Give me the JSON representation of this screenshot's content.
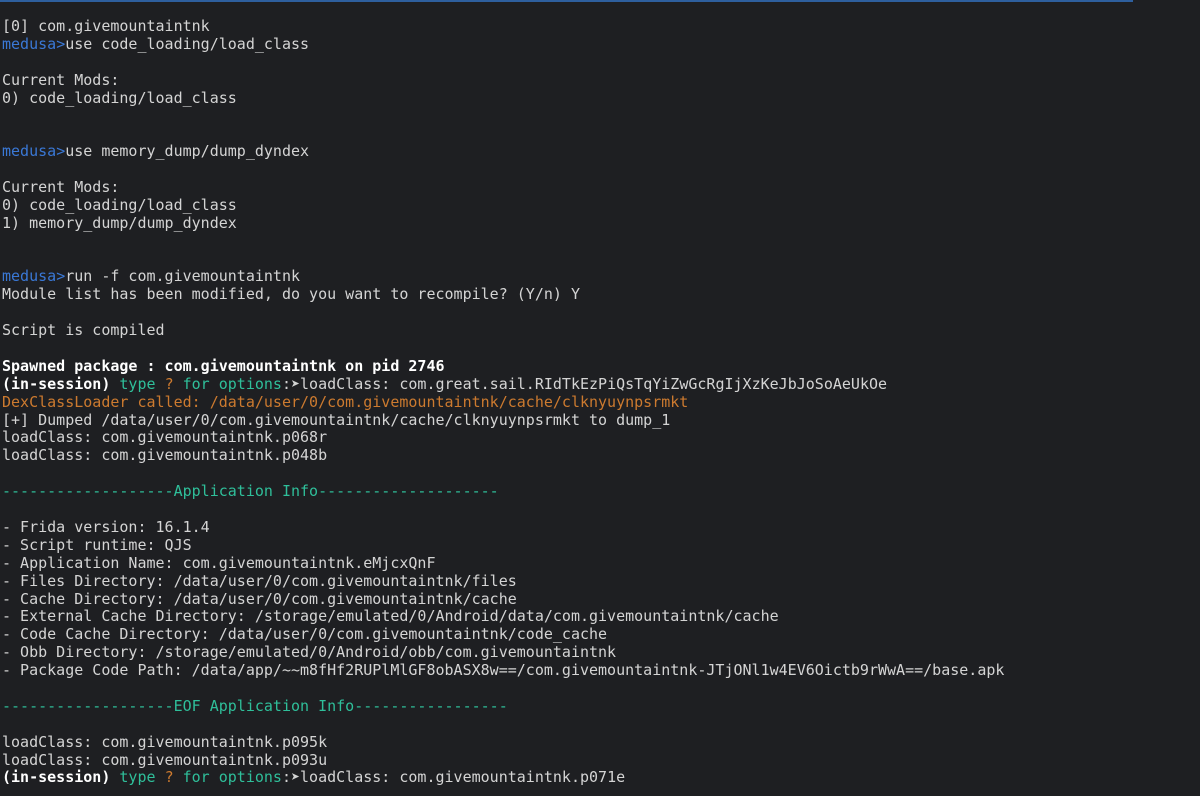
{
  "colors": {
    "background": "#1e1f22",
    "text": "#d4d4d4",
    "prompt_blue": "#3a78d6",
    "teal": "#2fbf9a",
    "orange": "#cc7a2f",
    "bold_white": "#ffffff",
    "top_accent": "#2e5f9e"
  },
  "terminal": {
    "lines": [
      {
        "segments": [
          {
            "text": "[0] com.givemountaintnk",
            "style": ""
          }
        ]
      },
      {
        "segments": [
          {
            "text": "medusa",
            "style": "blue"
          },
          {
            "text": ">",
            "style": "blue"
          },
          {
            "text": "use code_loading/load_class",
            "style": ""
          }
        ]
      },
      {
        "segments": []
      },
      {
        "segments": [
          {
            "text": "Current Mods:",
            "style": ""
          }
        ]
      },
      {
        "segments": [
          {
            "text": "0) code_loading/load_class",
            "style": ""
          }
        ]
      },
      {
        "segments": []
      },
      {
        "segments": []
      },
      {
        "segments": [
          {
            "text": "medusa",
            "style": "blue"
          },
          {
            "text": ">",
            "style": "blue"
          },
          {
            "text": "use memory_dump/dump_dyndex",
            "style": ""
          }
        ]
      },
      {
        "segments": []
      },
      {
        "segments": [
          {
            "text": "Current Mods:",
            "style": ""
          }
        ]
      },
      {
        "segments": [
          {
            "text": "0) code_loading/load_class",
            "style": ""
          }
        ]
      },
      {
        "segments": [
          {
            "text": "1) memory_dump/dump_dyndex",
            "style": ""
          }
        ]
      },
      {
        "segments": []
      },
      {
        "segments": []
      },
      {
        "segments": [
          {
            "text": "medusa",
            "style": "blue"
          },
          {
            "text": ">",
            "style": "blue"
          },
          {
            "text": "run -f com.givemountaintnk",
            "style": ""
          }
        ]
      },
      {
        "segments": [
          {
            "text": "Module list has been modified, do you want to recompile? (Y/n) Y",
            "style": ""
          }
        ]
      },
      {
        "segments": []
      },
      {
        "segments": [
          {
            "text": "Script is compiled",
            "style": ""
          }
        ]
      },
      {
        "segments": []
      },
      {
        "segments": [
          {
            "text": "Spawned package : com.givemountaintnk on pid 2746",
            "style": "bold"
          }
        ]
      },
      {
        "segments": [
          {
            "text": "(in-session)",
            "style": "bold"
          },
          {
            "text": " type ",
            "style": "teal"
          },
          {
            "text": "?",
            "style": "orange"
          },
          {
            "text": " for options",
            "style": "teal"
          },
          {
            "text": ":➤",
            "style": ""
          },
          {
            "text": "loadClass: com.great.sail.RIdTkEzPiQsTqYiZwGcRgIjXzKeJbJoSoAeUkOe",
            "style": ""
          }
        ]
      },
      {
        "segments": [
          {
            "text": "DexClassLoader called: /data/user/0/com.givemountaintnk/cache/clknyuynpsrmkt",
            "style": "orange"
          }
        ]
      },
      {
        "segments": [
          {
            "text": "[+] Dumped /data/user/0/com.givemountaintnk/cache/clknyuynpsrmkt to dump_1",
            "style": ""
          }
        ]
      },
      {
        "segments": [
          {
            "text": "loadClass: com.givemountaintnk.p068r",
            "style": ""
          }
        ]
      },
      {
        "segments": [
          {
            "text": "loadClass: com.givemountaintnk.p048b",
            "style": ""
          }
        ]
      },
      {
        "segments": []
      },
      {
        "segments": [
          {
            "text": "-------------------Application Info--------------------",
            "style": "teal"
          }
        ]
      },
      {
        "segments": []
      },
      {
        "segments": [
          {
            "text": "- Frida version: 16.1.4",
            "style": ""
          }
        ]
      },
      {
        "segments": [
          {
            "text": "- Script runtime: QJS",
            "style": ""
          }
        ]
      },
      {
        "segments": [
          {
            "text": "- Application Name: com.givemountaintnk.eMjcxQnF",
            "style": ""
          }
        ]
      },
      {
        "segments": [
          {
            "text": "- Files Directory: /data/user/0/com.givemountaintnk/files",
            "style": ""
          }
        ]
      },
      {
        "segments": [
          {
            "text": "- Cache Directory: /data/user/0/com.givemountaintnk/cache",
            "style": ""
          }
        ]
      },
      {
        "segments": [
          {
            "text": "- External Cache Directory: /storage/emulated/0/Android/data/com.givemountaintnk/cache",
            "style": ""
          }
        ]
      },
      {
        "segments": [
          {
            "text": "- Code Cache Directory: /data/user/0/com.givemountaintnk/code_cache",
            "style": ""
          }
        ]
      },
      {
        "segments": [
          {
            "text": "- Obb Directory: /storage/emulated/0/Android/obb/com.givemountaintnk",
            "style": ""
          }
        ]
      },
      {
        "segments": [
          {
            "text": "- Package Code Path: /data/app/~~m8fHf2RUPlMlGF8obASX8w==/com.givemountaintnk-JTjONl1w4EV6Oictb9rWwA==/base.apk",
            "style": ""
          }
        ]
      },
      {
        "segments": []
      },
      {
        "segments": [
          {
            "text": "-------------------EOF Application Info-----------------",
            "style": "teal"
          }
        ]
      },
      {
        "segments": []
      },
      {
        "segments": [
          {
            "text": "loadClass: com.givemountaintnk.p095k",
            "style": ""
          }
        ]
      },
      {
        "segments": [
          {
            "text": "loadClass: com.givemountaintnk.p093u",
            "style": ""
          }
        ]
      },
      {
        "segments": [
          {
            "text": "(in-session)",
            "style": "bold"
          },
          {
            "text": " type ",
            "style": "teal"
          },
          {
            "text": "?",
            "style": "orange"
          },
          {
            "text": " for options",
            "style": "teal"
          },
          {
            "text": ":➤",
            "style": ""
          },
          {
            "text": "loadClass: com.givemountaintnk.p071e",
            "style": ""
          }
        ]
      }
    ]
  }
}
